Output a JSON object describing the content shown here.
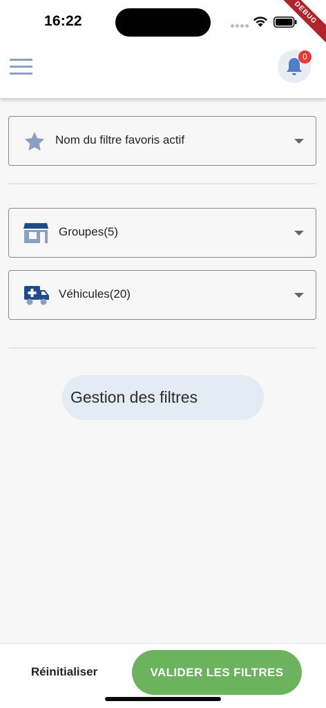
{
  "status_bar": {
    "time": "16:22",
    "debug_label": "DEBUG"
  },
  "app_bar": {
    "menu_icon": "hamburger-menu-icon",
    "notification_icon": "bell-icon",
    "notification_count": "0"
  },
  "filters": {
    "favorite": {
      "icon": "star-icon",
      "label": "Nom du filtre favoris actif"
    },
    "groups": {
      "icon": "store-icon",
      "label": "Groupes(5)"
    },
    "vehicles": {
      "icon": "ambulance-icon",
      "label": "Véhicules(20)"
    }
  },
  "manage_filters_label": "Gestion des filtres",
  "bottom_bar": {
    "reset_label": "Réinitialiser",
    "validate_label": "VALIDER LES FILTRES"
  },
  "colors": {
    "accent_blue": "#1f4b8e",
    "light_blue_icon": "#8aa0c2",
    "validate_green": "#6cb35e",
    "badge_red": "#e53935",
    "debug_red": "#b2242b"
  }
}
